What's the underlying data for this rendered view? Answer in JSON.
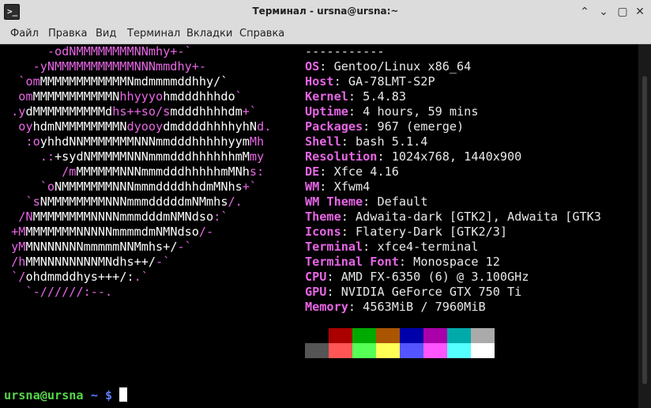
{
  "window": {
    "title": "Терминал - ursna@ursna:~",
    "icon": "terminal-icon",
    "buttons": {
      "up": "⌃",
      "minimize": "⌄",
      "maximize": "▢",
      "close": "✕"
    }
  },
  "menu": [
    "Файл",
    "Правка",
    "Вид",
    "Терминал",
    "Вкладки",
    "Справка"
  ],
  "logo_lines": [
    [
      [
        "      ",
        "w"
      ],
      [
        "-odNMMMMMMMMNNmhy+-`",
        "p"
      ]
    ],
    [
      [
        "    ",
        "w"
      ],
      [
        "-yNMMMMMMMMMMMNNNmmdhy+-",
        "p"
      ]
    ],
    [
      [
        "  ",
        "w"
      ],
      [
        "`om",
        "p"
      ],
      [
        "MMMMMMMMMMMMNmdmmmmddhhy/`",
        "w"
      ]
    ],
    [
      [
        "  ",
        "w"
      ],
      [
        "om",
        "p"
      ],
      [
        "MMMMMMMMMMMN",
        "w"
      ],
      [
        "hhyyyo",
        "p"
      ],
      [
        "hmdddhhhdo",
        "w"
      ],
      [
        "`",
        "p"
      ]
    ],
    [
      [
        " ",
        "w"
      ],
      [
        ".y",
        "p"
      ],
      [
        "dMMMMMMMMMMd",
        "w"
      ],
      [
        "hs++so/s",
        "p"
      ],
      [
        "mdddhhhhdm",
        "w"
      ],
      [
        "+`",
        "p"
      ]
    ],
    [
      [
        "  ",
        "w"
      ],
      [
        "oy",
        "p"
      ],
      [
        "hdmNMMMMMMMMN",
        "w"
      ],
      [
        "dyooy",
        "p"
      ],
      [
        "dmddddhhhhyhN",
        "w"
      ],
      [
        "d.",
        "p"
      ]
    ],
    [
      [
        "   ",
        "w"
      ],
      [
        ":o",
        "p"
      ],
      [
        "yhhdNNMMMMMMMNNNmmdddhhhhhyym",
        "w"
      ],
      [
        "Mh",
        "p"
      ]
    ],
    [
      [
        "     ",
        "w"
      ],
      [
        ".:",
        "p"
      ],
      [
        "+sydNMMMMMNNNmmmdddhhhhhhmM",
        "w"
      ],
      [
        "my",
        "p"
      ]
    ],
    [
      [
        "        ",
        "w"
      ],
      [
        "/m",
        "p"
      ],
      [
        "MMMMMMNNNmmmdddhhhhhmMNh",
        "w"
      ],
      [
        "s:",
        "p"
      ]
    ],
    [
      [
        "     ",
        "w"
      ],
      [
        "`o",
        "p"
      ],
      [
        "NMMMMMMMNNNmmmddddhhdmMNhs",
        "w"
      ],
      [
        "+`",
        "p"
      ]
    ],
    [
      [
        "   ",
        "w"
      ],
      [
        "`s",
        "p"
      ],
      [
        "NMMMMMMMMNNNmmmdddddmNMmhs",
        "w"
      ],
      [
        "/.",
        "p"
      ]
    ],
    [
      [
        "  ",
        "w"
      ],
      [
        "/N",
        "p"
      ],
      [
        "MMMMMMMMNNNNmmmdddmNMNdso",
        "w"
      ],
      [
        ":`",
        "p"
      ]
    ],
    [
      [
        " ",
        "w"
      ],
      [
        "+M",
        "p"
      ],
      [
        "MMMMMMMNNNNNmmmmdmNMNdso",
        "w"
      ],
      [
        "/-",
        "p"
      ]
    ],
    [
      [
        " ",
        "w"
      ],
      [
        "yM",
        "p"
      ],
      [
        "MNNNNNNNmmmmmNNMmhs+/",
        "w"
      ],
      [
        "-`",
        "p"
      ]
    ],
    [
      [
        " ",
        "w"
      ],
      [
        "/h",
        "p"
      ],
      [
        "MMNNNNNNNNMNdhs++/",
        "w"
      ],
      [
        "-`",
        "p"
      ]
    ],
    [
      [
        " ",
        "w"
      ],
      [
        "`/",
        "p"
      ],
      [
        "ohdmmddhys+++/:",
        "w"
      ],
      [
        ".`",
        "p"
      ]
    ],
    [
      [
        "   ",
        "w"
      ],
      [
        "`-//////:--.",
        "p"
      ]
    ]
  ],
  "info": {
    "separator": "-----------",
    "rows": [
      {
        "key": "OS",
        "value": "Gentoo/Linux x86_64"
      },
      {
        "key": "Host",
        "value": "GA-78LMT-S2P"
      },
      {
        "key": "Kernel",
        "value": "5.4.83"
      },
      {
        "key": "Uptime",
        "value": "4 hours, 59 mins"
      },
      {
        "key": "Packages",
        "value": "967 (emerge)"
      },
      {
        "key": "Shell",
        "value": "bash 5.1.4"
      },
      {
        "key": "Resolution",
        "value": "1024x768, 1440x900"
      },
      {
        "key": "DE",
        "value": "Xfce 4.16"
      },
      {
        "key": "WM",
        "value": "Xfwm4"
      },
      {
        "key": "WM Theme",
        "value": "Default"
      },
      {
        "key": "Theme",
        "value": "Adwaita-dark [GTK2], Adwaita [GTK3"
      },
      {
        "key": "Icons",
        "value": "Flatery-Dark [GTK2/3]"
      },
      {
        "key": "Terminal",
        "value": "xfce4-terminal"
      },
      {
        "key": "Terminal Font",
        "value": "Monospace 12"
      },
      {
        "key": "CPU",
        "value": "AMD FX-6350 (6) @ 3.100GHz"
      },
      {
        "key": "GPU",
        "value": "NVIDIA GeForce GTX 750 Ti"
      },
      {
        "key": "Memory",
        "value": "4563MiB / 7960MiB"
      }
    ]
  },
  "palette": {
    "normal": [
      "#000000",
      "#aa0000",
      "#00aa00",
      "#aa5500",
      "#0000aa",
      "#aa00aa",
      "#00aaaa",
      "#aaaaaa"
    ],
    "bright": [
      "#555555",
      "#ff5555",
      "#55ff55",
      "#ffff55",
      "#5555ff",
      "#ff55ff",
      "#55ffff",
      "#ffffff"
    ]
  },
  "prompt": {
    "user_host": "ursna@ursna",
    "dir": " ~ $"
  }
}
